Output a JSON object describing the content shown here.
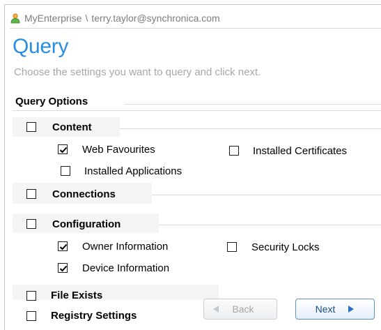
{
  "header": {
    "org": "MyEnterprise",
    "separator": "\\",
    "user": "terry.taylor@synchronica.com"
  },
  "page": {
    "title": "Query",
    "subtitle": "Choose the settings you want to query and click next."
  },
  "query_options": {
    "title": "Query Options",
    "sections": [
      {
        "label": "Content",
        "checked": false,
        "items": [
          {
            "label": "Web Favourites",
            "checked": true
          },
          {
            "label": "Installed Certificates",
            "checked": false
          },
          {
            "label": "Installed Applications",
            "checked": false
          }
        ]
      },
      {
        "label": "Connections",
        "checked": false,
        "items": []
      },
      {
        "label": "Configuration",
        "checked": false,
        "items": [
          {
            "label": "Owner Information",
            "checked": true
          },
          {
            "label": "Security Locks",
            "checked": false
          },
          {
            "label": "Device Information",
            "checked": true
          }
        ]
      },
      {
        "label": "File Exists",
        "checked": false,
        "items": []
      },
      {
        "label": "Registry Settings",
        "checked": false,
        "items": []
      }
    ]
  },
  "buttons": {
    "back": "Back",
    "next": "Next"
  },
  "colors": {
    "title_blue": "#2a8ee0",
    "subtitle_gray": "#a8a8a8",
    "next_text": "#1c4e86"
  }
}
